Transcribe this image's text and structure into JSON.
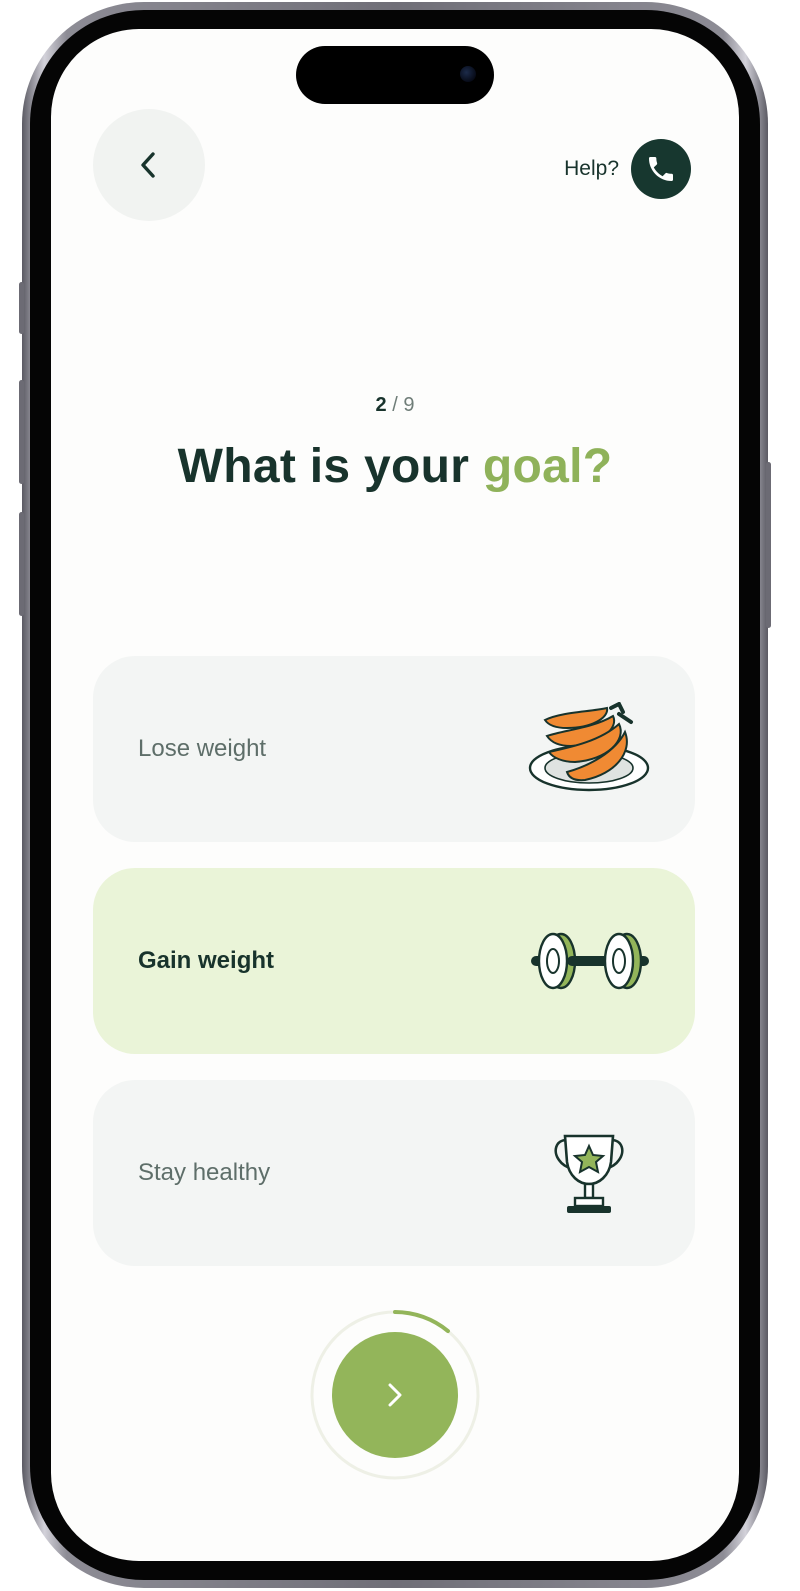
{
  "header": {
    "help_label": "Help?",
    "back_icon": "chevron-left-icon",
    "phone_icon": "phone-icon"
  },
  "progress": {
    "current": "2",
    "separator": "/",
    "total": "9",
    "ring_fraction": 0.11
  },
  "question": {
    "title_main": "What is your",
    "title_accent": "goal?"
  },
  "options": [
    {
      "label": "Lose weight",
      "icon": "bananas-icon",
      "selected": false
    },
    {
      "label": "Gain weight",
      "icon": "dumbbell-icon",
      "selected": true
    },
    {
      "label": "Stay healthy",
      "icon": "trophy-icon",
      "selected": false
    }
  ],
  "next": {
    "icon": "chevron-right-icon"
  },
  "colors": {
    "primary_dark": "#17372f",
    "accent_green": "#93b55a",
    "selected_bg": "#eaf4d8",
    "option_bg": "#f3f5f4",
    "banana_orange": "#f08a33"
  }
}
